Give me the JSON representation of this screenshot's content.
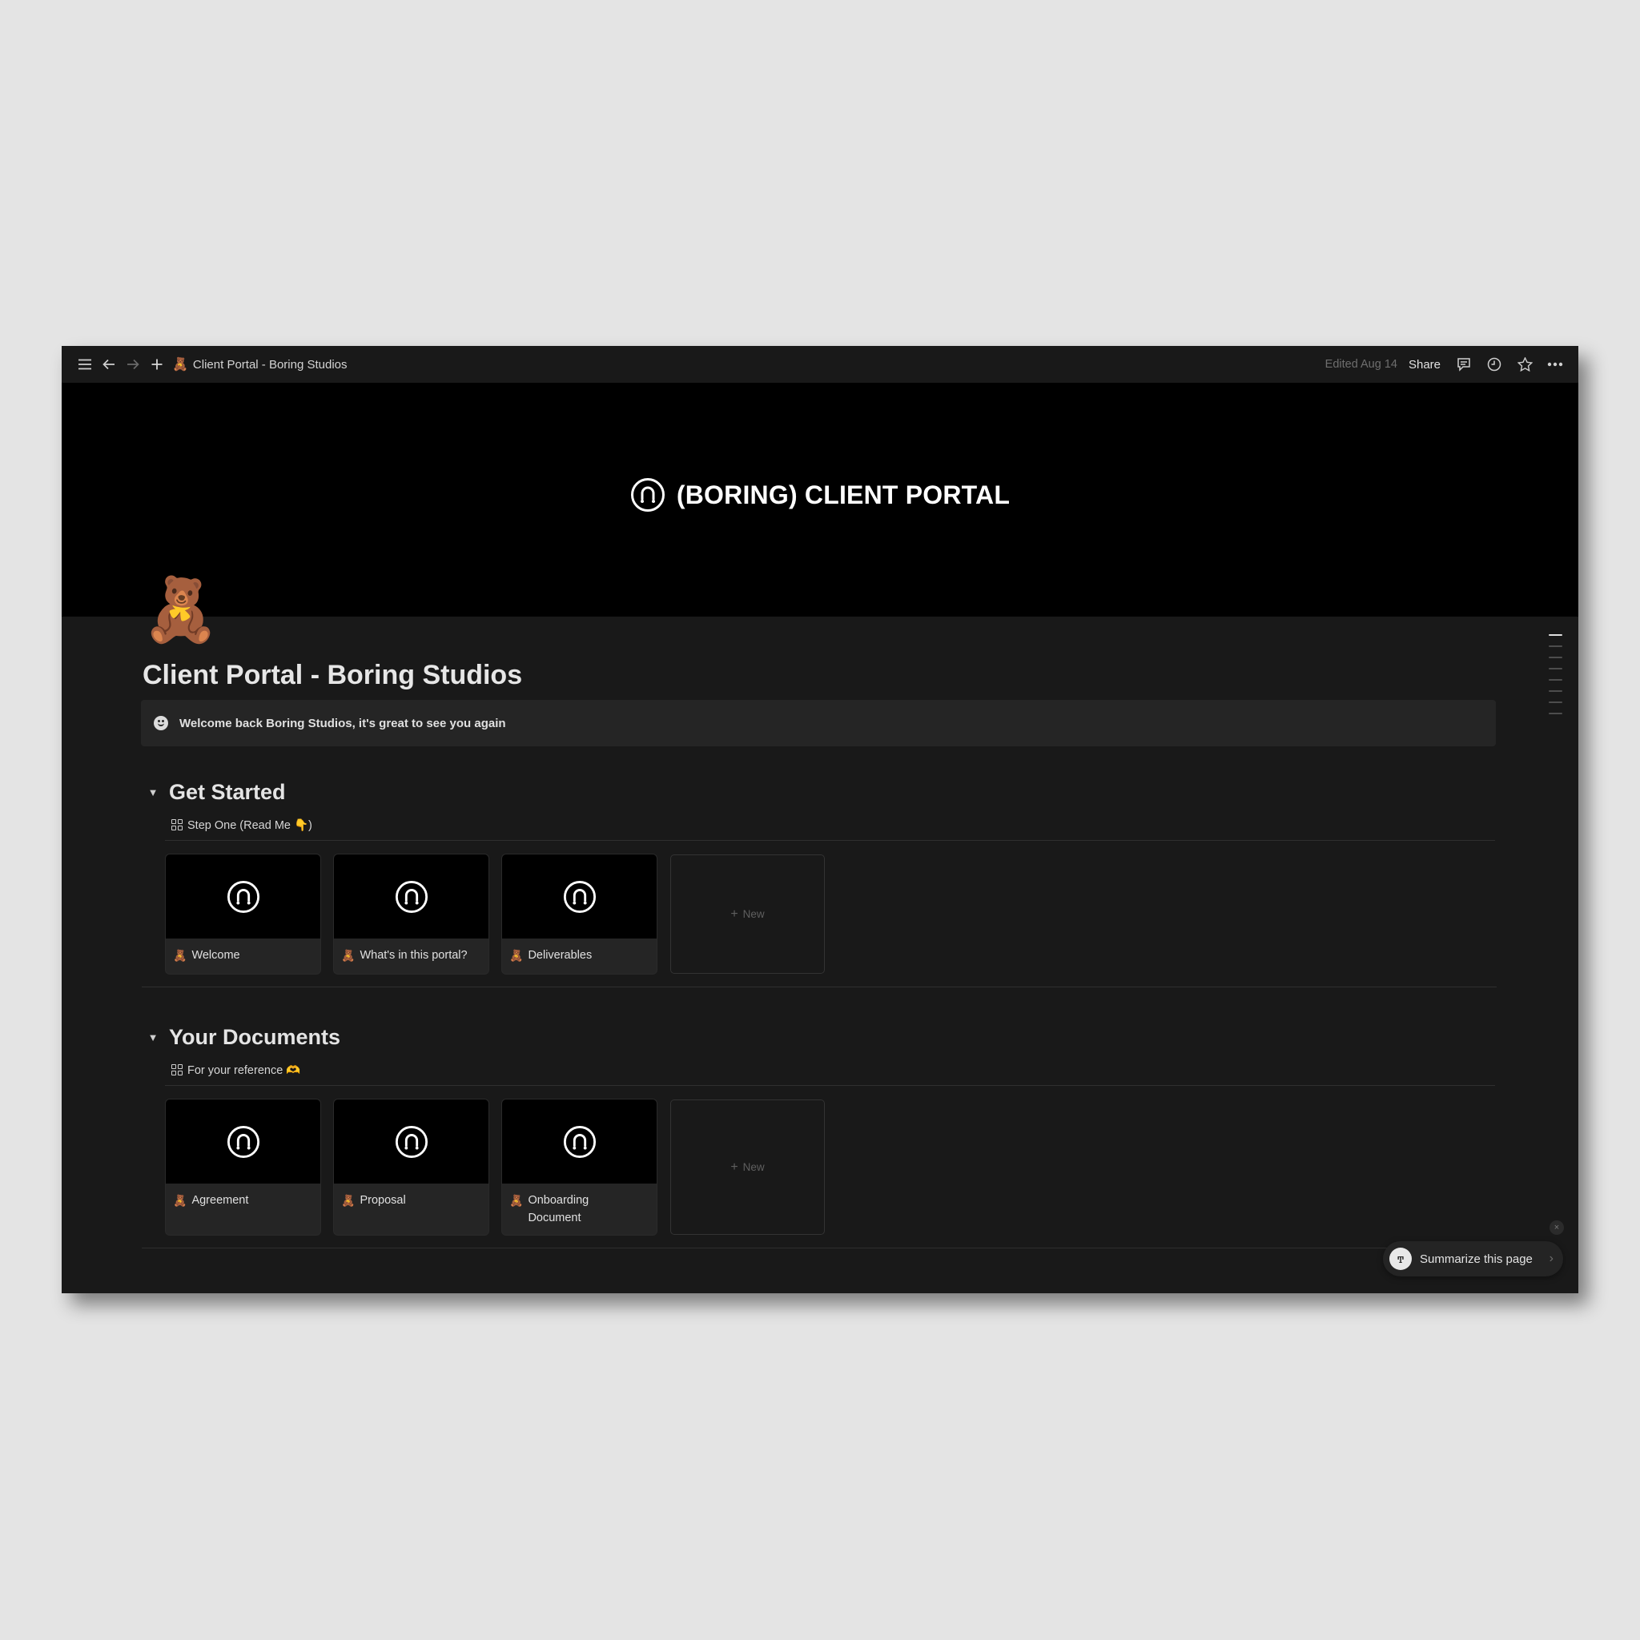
{
  "topbar": {
    "breadcrumb_emoji": "🧸",
    "breadcrumb_title": "Client Portal - Boring Studios",
    "edited": "Edited Aug 14",
    "share_label": "Share",
    "icons": [
      "menu-icon",
      "back-arrow-icon",
      "forward-arrow-icon",
      "plus-icon",
      "comment-icon",
      "clock-icon",
      "star-icon",
      "more-icon"
    ]
  },
  "cover": {
    "title": "(BORING) CLIENT PORTAL",
    "logo_icon": "smile-circle-logo-icon"
  },
  "page": {
    "icon": "🧸",
    "title": "Client Portal - Boring Studios",
    "callout_text": "Welcome back Boring Studios, it's great to see you again"
  },
  "sections": [
    {
      "heading": "Get Started",
      "view_label": "Step One (Read Me 👇)",
      "cards": [
        {
          "emoji": "🧸",
          "title": "Welcome"
        },
        {
          "emoji": "🧸",
          "title": "What's in this portal?"
        },
        {
          "emoji": "🧸",
          "title": "Deliverables"
        }
      ],
      "new_label": "New"
    },
    {
      "heading": "Your Documents",
      "view_label": "For your reference 🫶",
      "cards": [
        {
          "emoji": "🧸",
          "title": "Agreement"
        },
        {
          "emoji": "🧸",
          "title": "Proposal"
        },
        {
          "emoji": "🧸",
          "title": "Onboarding Document"
        }
      ],
      "new_label": "New"
    }
  ],
  "summarize": {
    "label": "Summarize this page",
    "close": "×",
    "chevron": "›",
    "ai_glyph": "ͳ"
  },
  "add_icon": "+"
}
